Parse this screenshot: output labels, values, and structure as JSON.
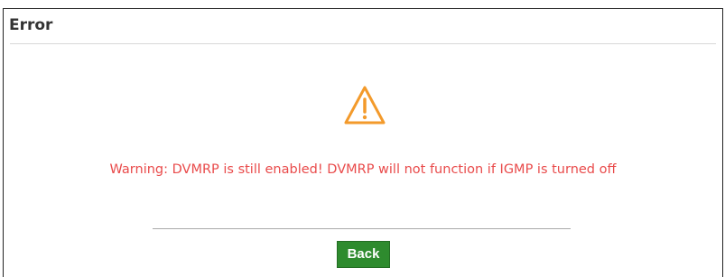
{
  "dialog": {
    "title": "Error",
    "message": "Warning: DVMRP is still enabled! DVMRP will not function if IGMP is turned off",
    "back_label": "Back",
    "icon": "warning-icon"
  },
  "colors": {
    "warning_orange": "#f39a2b",
    "message_red": "#e94b4b",
    "button_green": "#2e8b2e"
  }
}
